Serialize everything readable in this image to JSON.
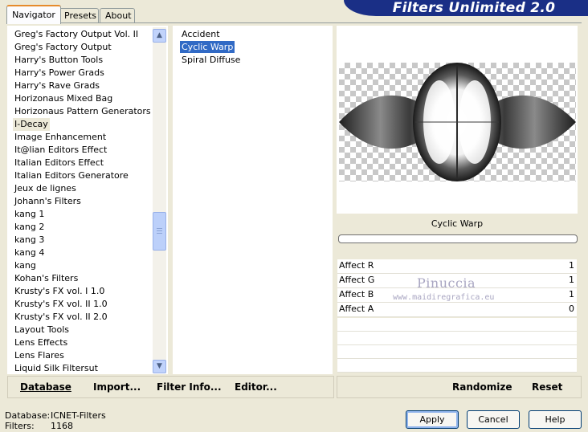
{
  "header": {
    "title": "Filters Unlimited 2.0"
  },
  "tabs": [
    {
      "label": "Navigator",
      "active": true
    },
    {
      "label": "Presets",
      "active": false
    },
    {
      "label": "About",
      "active": false
    }
  ],
  "categories": [
    "Greg's Factory Output Vol. II",
    "Greg's Factory Output",
    "Harry's Button Tools",
    "Harry's Power Grads",
    "Harry's Rave Grads",
    "Horizonaus Mixed Bag",
    "Horizonaus Pattern Generators",
    "I-Decay",
    "Image Enhancement",
    "It@lian Editors Effect",
    "Italian Editors Effect",
    "Italian Editors Generatore",
    "Jeux de lignes",
    "Johann's Filters",
    "kang 1",
    "kang 2",
    "kang 3",
    "kang 4",
    "kang",
    "Kohan's Filters",
    "Krusty's FX vol. I 1.0",
    "Krusty's FX vol. II 1.0",
    "Krusty's FX vol. II 2.0",
    "Layout Tools",
    "Lens Effects",
    "Lens Flares",
    "Liquid Silk Filtersut"
  ],
  "selected_category": "I-Decay",
  "filters": [
    "Accident",
    "Cyclic Warp",
    "Spiral Diffuse"
  ],
  "selected_filter": "Cyclic Warp",
  "controls": {
    "filter_name": "Cyclic Warp",
    "params": [
      {
        "label": "Affect R",
        "value": "1"
      },
      {
        "label": "Affect G",
        "value": "1"
      },
      {
        "label": "Affect B",
        "value": "1"
      },
      {
        "label": "Affect A",
        "value": "0"
      }
    ]
  },
  "watermark": {
    "line1": "Pinuccia",
    "line2": "www.maidiregrafica.eu"
  },
  "toolbar_left": {
    "database": "Database",
    "import": "Import...",
    "filter_info": "Filter Info...",
    "editor": "Editor..."
  },
  "toolbar_right": {
    "randomize": "Randomize",
    "reset": "Reset"
  },
  "status": {
    "database_label": "Database:",
    "database_value": "ICNET-Filters",
    "filters_label": "Filters:",
    "filters_value": "1168"
  },
  "buttons": {
    "apply": "Apply",
    "cancel": "Cancel",
    "help": "Help"
  },
  "icons": {
    "scroll_up": "chevron-up-icon",
    "scroll_down": "chevron-down-icon"
  }
}
